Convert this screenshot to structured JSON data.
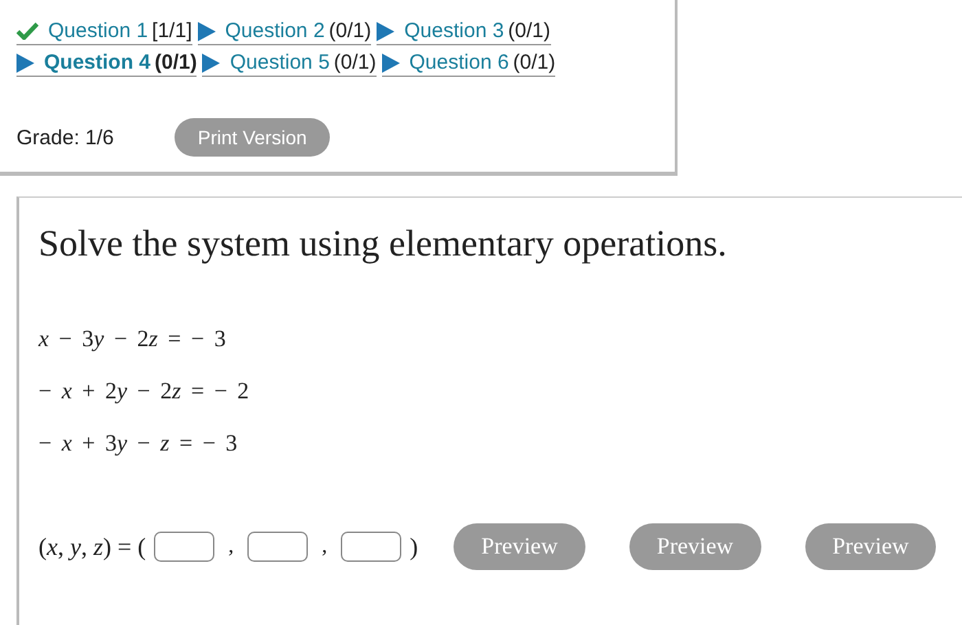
{
  "questions": [
    {
      "label": "Question 1",
      "score": "[1/1]",
      "kind": "correct",
      "selected": false
    },
    {
      "label": "Question 2",
      "score": "(0/1)",
      "kind": "pending",
      "selected": false
    },
    {
      "label": "Question 3",
      "score": "(0/1)",
      "kind": "pending",
      "selected": false
    },
    {
      "label": "Question 4",
      "score": "(0/1)",
      "kind": "pending",
      "selected": true
    },
    {
      "label": "Question 5",
      "score": "(0/1)",
      "kind": "pending",
      "selected": false
    },
    {
      "label": "Question 6",
      "score": "(0/1)",
      "kind": "pending",
      "selected": false
    }
  ],
  "grade": "Grade: 1/6",
  "print_button": "Print Version",
  "prompt": "Solve the system using elementary operations.",
  "equations": [
    "x − 3y − 2z =  − 3",
    "− x + 2y − 2z =  − 2",
    "− x + 3y − z =  − 3"
  ],
  "answer": {
    "lhs": "(x, y, z) = (",
    "separators": [
      ",",
      ","
    ],
    "close": ")"
  },
  "preview_buttons": [
    "Preview",
    "Preview",
    "Preview"
  ]
}
